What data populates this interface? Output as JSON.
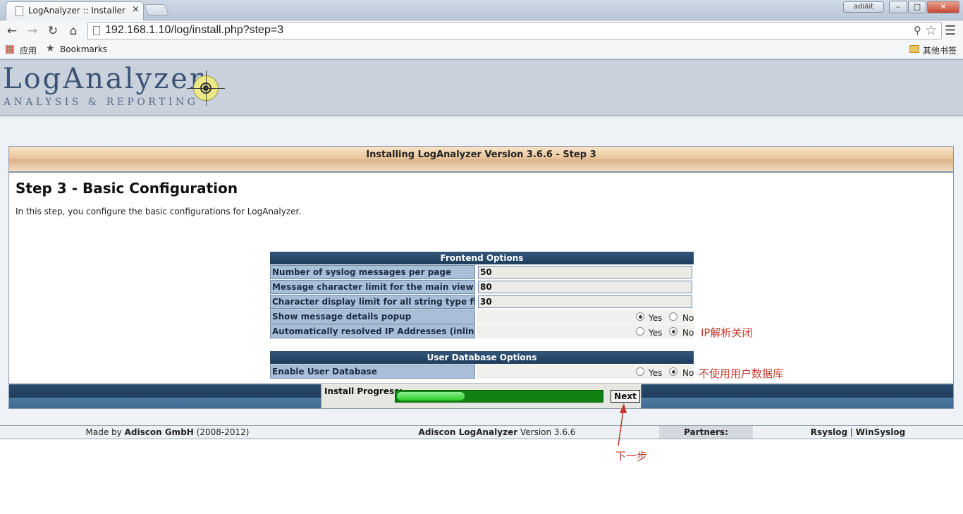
{
  "browser": {
    "tab_title": "LogAnalyzer :: Installer S",
    "tab_close": "×",
    "user_button": "adiäit",
    "url": "192.168.1.10/log/install.php?step=3",
    "bookmarks": {
      "apps_label": "应用",
      "bookmarks_label": "Bookmarks",
      "other_label": "其他书签"
    }
  },
  "logo": {
    "main": "LogAnalyzer",
    "sub": "ANALYSIS & REPORTING"
  },
  "install": {
    "title": "Installing LogAnalyzer Version 3.6.6 - Step 3",
    "step_title": "Step 3 - Basic Configuration",
    "step_desc": "In this step, you configure the basic configurations for LogAnalyzer."
  },
  "frontend": {
    "header": "Frontend Options",
    "rows": [
      {
        "label": "Number of syslog messages per page",
        "value": "50"
      },
      {
        "label": "Message character limit for the main view",
        "value": "80"
      },
      {
        "label": "Character display limit for all string type fields",
        "value": "30"
      }
    ],
    "radios": [
      {
        "label": "Show message details popup",
        "yes": "Yes",
        "no": "No",
        "selected": "yes"
      },
      {
        "label": "Automatically resolved IP Addresses (inline)",
        "yes": "Yes",
        "no": "No",
        "selected": "no"
      }
    ]
  },
  "userdb": {
    "header": "User Database Options",
    "label": "Enable User Database",
    "yes": "Yes",
    "no": "No",
    "selected": "no"
  },
  "annotations": {
    "ip_off": "IP解析关闭",
    "no_userdb": "不使用用户数据库",
    "next_step": "下一步"
  },
  "progress": {
    "label": "Install Progress:",
    "fraction": 0.33,
    "next_label": "Next"
  },
  "footer": {
    "made_by_prefix": "Made by",
    "made_by_company": "Adiscon GmbH",
    "made_by_years": "(2008-2012)",
    "product": "Adiscon LogAnalyzer",
    "version": "Version 3.6.6",
    "partners": "Partners:",
    "rsyslog": "Rsyslog",
    "separator": "|",
    "winsyslog": "WinSyslog"
  },
  "colors": {
    "annotation": "#c0392b",
    "progress_fill": "#2bcc2b",
    "table_header": "#1e3d5d"
  }
}
